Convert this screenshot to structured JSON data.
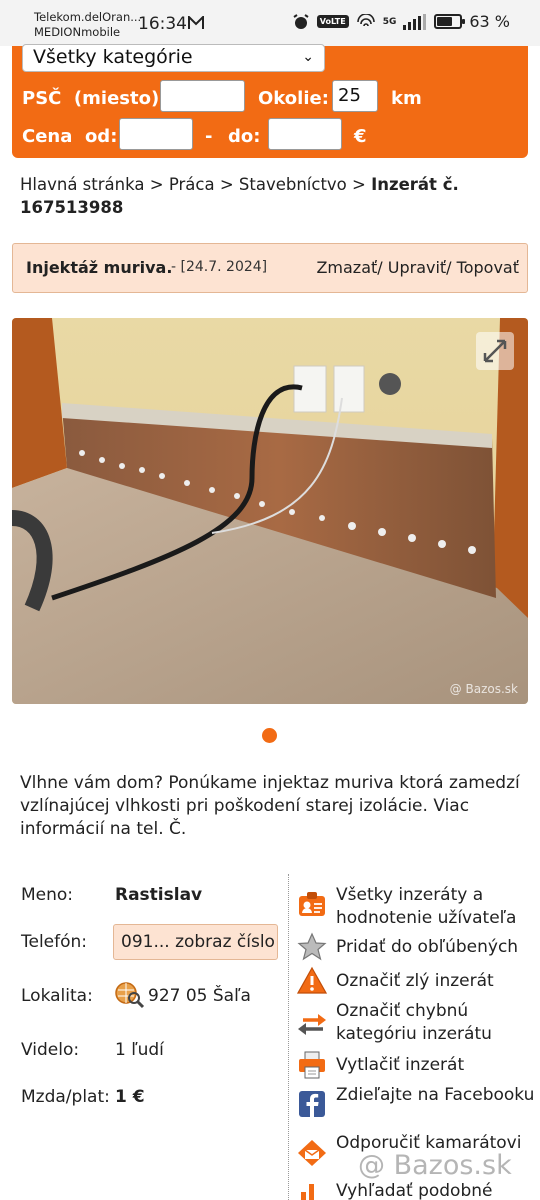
{
  "status_bar": {
    "carrier_line1": "Telekom.delOran...",
    "carrier_line2": "MEDIONmobile",
    "time": "16:34",
    "network": "VoLTE",
    "signal": "5G",
    "battery_percent": "63 %",
    "battery_level": 0.63
  },
  "search": {
    "category_value": "Všetky kategórie",
    "psc_label": "PSČ",
    "psc_hint": "(miesto):",
    "psc_value": "",
    "radius_label": "Okolie:",
    "radius_value": "25",
    "radius_unit": "km",
    "price_label": "Cena",
    "price_from_label": "od:",
    "price_from_value": "",
    "price_dash": "-",
    "price_to_label": "do:",
    "price_to_value": "",
    "currency": "€"
  },
  "breadcrumb": {
    "home": "Hlavná stránka",
    "sep": ">",
    "cat1": "Práca",
    "cat2": "Stavebníctvo",
    "current": "Inzerát č. 167513988"
  },
  "listing": {
    "title": "Injektáž muriva.",
    "date": "- [24.7. 2024]",
    "actions": "Zmazať/ Upraviť/ Topovať",
    "photo_watermark": "Bazos.sk",
    "description": "Vlhne vám dom? Ponúkame injektaz muriva ktorá zamedzí vzlínajúcej vlhkosti pri poškodení starej izolácie. Viac informácií na tel. Č."
  },
  "seller": {
    "name_label": "Meno:",
    "name": "Rastislav",
    "phone_label": "Telefón:",
    "phone_button": "091... zobraz číslo",
    "location_label": "Lokalita:",
    "location": "927 05 Šaľa",
    "views_label": "Videlo:",
    "views": "1 ľudí",
    "salary_label": "Mzda/plat:",
    "salary": "1 €"
  },
  "actions": [
    {
      "icon": "seller-card-icon",
      "label": "Všetky inzeráty a hodnotenie užívateľa"
    },
    {
      "icon": "star-icon",
      "label": "Pridať do obľúbených"
    },
    {
      "icon": "warning-icon",
      "label": "Označiť zlý inzerát"
    },
    {
      "icon": "swap-arrows-icon",
      "label": "Označiť chybnú kategóriu inzerátu"
    },
    {
      "icon": "printer-icon",
      "label": "Vytlačiť inzerát"
    },
    {
      "icon": "facebook-icon",
      "label": "Zdieľajte na Facebooku"
    },
    {
      "icon": "envelope-icon",
      "label": "Odporučiť kamarátovi"
    },
    {
      "icon": "search-similar-icon",
      "label": "Vyhľadať podobné"
    }
  ],
  "page_watermark": "Bazos.sk",
  "colors": {
    "accent": "#f26b14",
    "highlight_bg": "#fde3d2",
    "facebook": "#3b5998"
  }
}
